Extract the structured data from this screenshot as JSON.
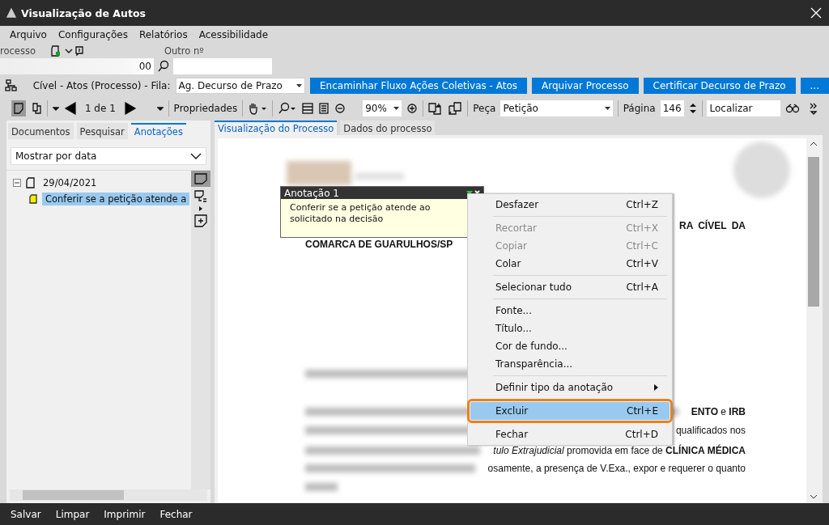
{
  "window": {
    "title": "Visualização de Autos"
  },
  "menu": [
    "Arquivo",
    "Configurações",
    "Relatórios",
    "Acessibilidade"
  ],
  "process": {
    "label": "rocesso",
    "number_tail": "00",
    "other_label": "Outro nº"
  },
  "queue": {
    "label": "Cível - Atos (Processo) - Fila:",
    "value": "Ag. Decurso de Prazo"
  },
  "actions": [
    "Encaminhar Fluxo Ações Coletivas - Atos",
    "Arquivar Processo",
    "Certificar Decurso de Prazo",
    "..."
  ],
  "toolbar": {
    "page_count": "1 de 1",
    "properties": "Propriedades",
    "zoom": "90%",
    "piece_label": "Peça",
    "piece": "Petição",
    "page_label": "Página",
    "page": "146",
    "find": "Localizar"
  },
  "left_tabs": [
    {
      "label": "Documentos",
      "selected": false
    },
    {
      "label": "Pesquisar",
      "selected": false
    },
    {
      "label": "Anotações",
      "selected": true
    }
  ],
  "sort": "Mostrar por data",
  "tree": [
    {
      "label": "29/04/2021",
      "expanded": true,
      "children": [
        {
          "label": "Conferir se a petição atende a",
          "selected": true
        }
      ]
    }
  ],
  "viewer_tabs": [
    {
      "label": "Visualização do Processo",
      "selected": true
    },
    {
      "label": "Dados do processo",
      "selected": false
    }
  ],
  "document": [
    {
      "kind": "heading",
      "text": "RA  CÍVEL  DA"
    },
    {
      "kind": "title",
      "text": "COMARCA DE GUARULHOS/SP"
    },
    {
      "kind": "body",
      "text": "**ENTO**   e   **IRB**"
    },
    {
      "kind": "body",
      "text": "qualificados nos"
    },
    {
      "kind": "body",
      "text": "*tulo Extrajudicial* promovida em face de **CLÍNICA MÉDICA**"
    },
    {
      "kind": "body",
      "text": "osamente, a presença de V.Exa., expor e requerer o quanto"
    }
  ],
  "note": {
    "title": "Anotação 1",
    "text": "Conferir se a petição atende ao solicitado na decisão"
  },
  "context_menu": [
    {
      "kind": "item",
      "label": "Desfazer",
      "shortcut": "Ctrl+Z",
      "disabled": false,
      "selected": false
    },
    {
      "kind": "separator"
    },
    {
      "kind": "item",
      "label": "Recortar",
      "shortcut": "Ctrl+X",
      "disabled": true,
      "selected": false
    },
    {
      "kind": "item",
      "label": "Copiar",
      "shortcut": "Ctrl+C",
      "disabled": true,
      "selected": false
    },
    {
      "kind": "item",
      "label": "Colar",
      "shortcut": "Ctrl+V",
      "disabled": false,
      "selected": false
    },
    {
      "kind": "separator"
    },
    {
      "kind": "item",
      "label": "Selecionar tudo",
      "shortcut": "Ctrl+A",
      "disabled": false,
      "selected": false
    },
    {
      "kind": "separator"
    },
    {
      "kind": "item",
      "label": "Fonte...",
      "disabled": false,
      "selected": false
    },
    {
      "kind": "item",
      "label": "Título...",
      "disabled": false,
      "selected": false
    },
    {
      "kind": "item",
      "label": "Cor de fundo...",
      "disabled": false,
      "selected": false
    },
    {
      "kind": "item",
      "label": "Transparência...",
      "disabled": false,
      "selected": false
    },
    {
      "kind": "separator"
    },
    {
      "kind": "submenu",
      "label": "Definir tipo da anotação",
      "disabled": false,
      "selected": false
    },
    {
      "kind": "separator"
    },
    {
      "kind": "item",
      "label": "Excluir",
      "shortcut": "Ctrl+E",
      "disabled": false,
      "selected": true
    },
    {
      "kind": "separator"
    },
    {
      "kind": "item",
      "label": "Fechar",
      "shortcut": "Ctrl+D",
      "disabled": false,
      "selected": false
    }
  ],
  "footer": [
    "Salvar",
    "Limpar",
    "Imprimir",
    "Fechar"
  ]
}
